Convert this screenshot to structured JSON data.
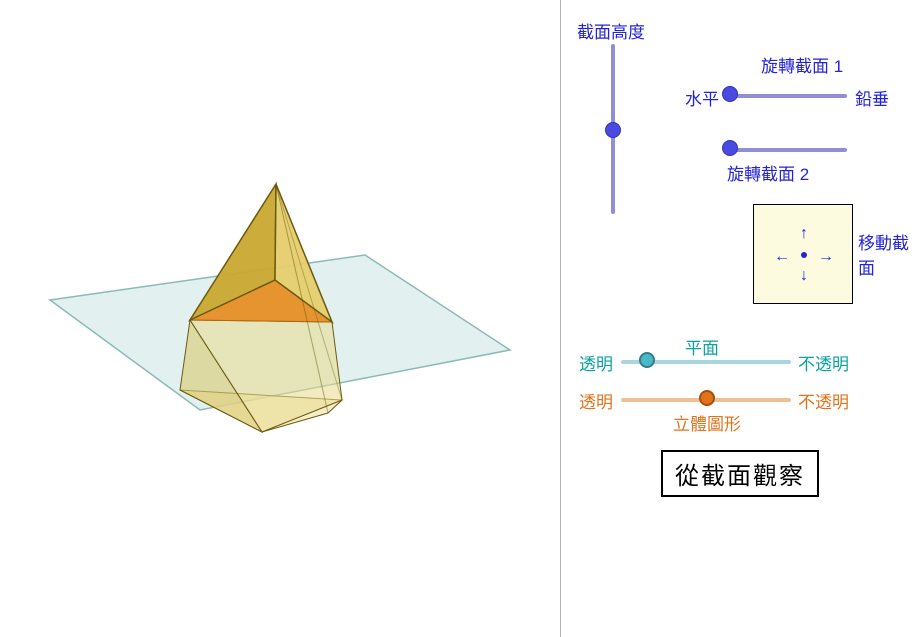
{
  "scene": {
    "shape": "pyramid",
    "plane_visible": true
  },
  "section_height": {
    "label": "截面高度",
    "value": 45,
    "min": 0,
    "max": 100
  },
  "rotate_section_1": {
    "label": "旋轉截面 1",
    "left_label": "水平",
    "right_label": "鉛垂",
    "value": 0,
    "min": 0,
    "max": 100
  },
  "rotate_section_2": {
    "label": "旋轉截面 2",
    "value": 0,
    "min": 0,
    "max": 100
  },
  "move_section": {
    "label": "移動截面",
    "arrows": {
      "up": "↑",
      "down": "↓",
      "left": "←",
      "right": "→"
    }
  },
  "plane_opacity": {
    "title": "平面",
    "left_label": "透明",
    "right_label": "不透明",
    "value": 15,
    "min": 0,
    "max": 100,
    "color": "#4ab8c8"
  },
  "solid_opacity": {
    "title": "立體圖形",
    "left_label": "透明",
    "right_label": "不透明",
    "value": 50,
    "min": 0,
    "max": 100,
    "color": "#e0741c"
  },
  "button": {
    "observe_label": "從截面觀察"
  }
}
